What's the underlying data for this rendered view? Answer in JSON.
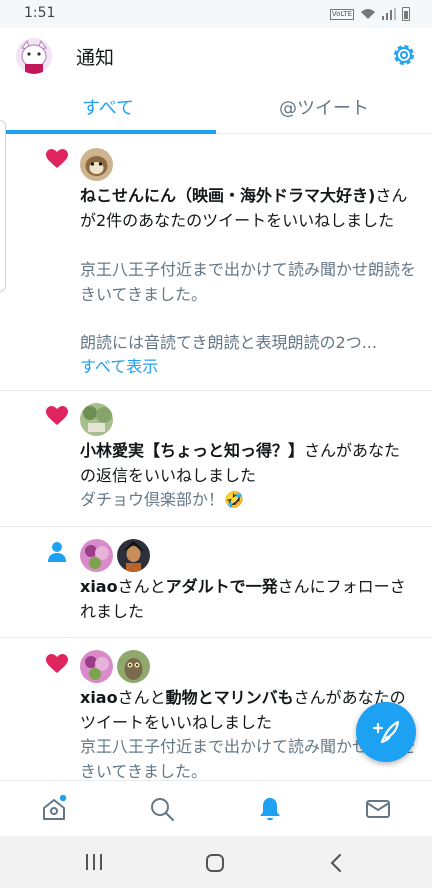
{
  "status_bar": {
    "time": "1:51",
    "volte_label": "VoLTE"
  },
  "header": {
    "title": "通知"
  },
  "tabs": [
    {
      "label": "すべて",
      "active": true
    },
    {
      "label": "@ツイート",
      "active": false
    }
  ],
  "notifications": [
    {
      "type": "like",
      "icon": "heart-icon",
      "actor_bold": "ねこせんにん（映画・海外ドラマ大好き)",
      "action": "さんが2件のあなたのツイートをいいねしました",
      "preview_line1": "京王八王子付近まで出かけて読み聞かせ朗読をきいてきました。",
      "preview_line2": "朗読には音読てき朗読と表現朗読の2つ...",
      "show_all": "すべて表示"
    },
    {
      "type": "like",
      "icon": "heart-icon",
      "actor_bold": "小林愛実【ちょっと知っ得？】",
      "action": "さんがあなたの返信をいいねしました",
      "preview": "ダチョウ倶楽部か！🤣"
    },
    {
      "type": "follow",
      "icon": "person-icon",
      "actor1_bold": "xiao",
      "and": "さんと",
      "actor2_bold": "アダルトで一発",
      "action": "さんにフォローされました"
    },
    {
      "type": "like",
      "icon": "heart-icon",
      "actor1_bold": "xiao",
      "and": "さんと",
      "actor2_bold": "動物とマリンバも",
      "action": "さんがあなたのツイートをいいねしました",
      "preview": "京王八王子付近まで出かけて読み聞かせ朗読をきいてきました。"
    }
  ],
  "bottom_nav": [
    {
      "icon": "home-icon",
      "has_badge": true
    },
    {
      "icon": "search-icon"
    },
    {
      "icon": "bell-icon",
      "active": true
    },
    {
      "icon": "mail-icon"
    }
  ],
  "colors": {
    "accent": "#1da1f2",
    "heart": "#e0245e",
    "muted": "#657786",
    "text": "#14171a"
  }
}
